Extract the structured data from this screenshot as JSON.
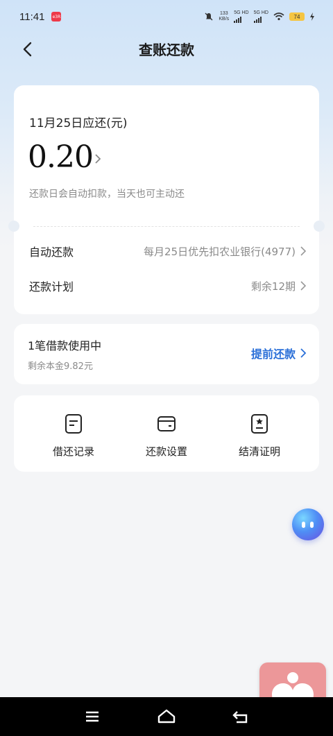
{
  "status_bar": {
    "time": "11:41",
    "notif_badge": "e3R",
    "net_speed_top": "133",
    "net_speed_bottom": "KB/s",
    "sim1": "5G HD",
    "sim2": "5G HD",
    "battery": "74"
  },
  "header": {
    "title": "查账还款"
  },
  "due": {
    "label": "11月25日应还(元)",
    "amount": "0.20",
    "note": "还款日会自动扣款，当天也可主动还"
  },
  "rows": [
    {
      "label": "自动还款",
      "value": "每月25日优先扣农业银行(4977)"
    },
    {
      "label": "还款计划",
      "value": "剩余12期"
    }
  ],
  "loan": {
    "title": "1笔借款使用中",
    "subtitle": "剩余本金9.82元",
    "prepay": "提前还款"
  },
  "menu": [
    {
      "label": "借还记录",
      "icon": "record-icon"
    },
    {
      "label": "还款设置",
      "icon": "wallet-icon"
    },
    {
      "label": "结清证明",
      "icon": "certificate-icon"
    }
  ],
  "colors": {
    "accent": "#2a6fd8",
    "health": "#ec9799"
  }
}
